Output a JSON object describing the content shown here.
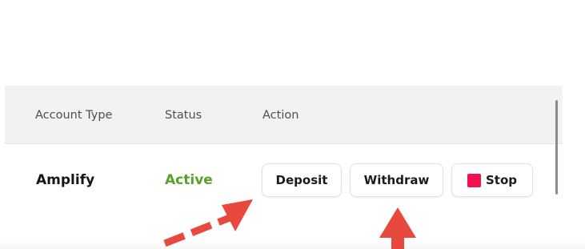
{
  "table": {
    "columns": [
      {
        "label": "Account Type"
      },
      {
        "label": "Status"
      },
      {
        "label": "Action"
      }
    ],
    "rows": [
      {
        "account_type": "Amplify",
        "status": "Active",
        "actions": {
          "deposit_label": "Deposit",
          "withdraw_label": "Withdraw",
          "stop_label": "Stop"
        }
      }
    ]
  },
  "colors": {
    "status_active": "#5aa02c",
    "stop_square": "#f0134f",
    "annotation_arrow": "#e8493f",
    "header_background": "#f3f2f2"
  },
  "icons": {
    "stop": "stop-square-icon",
    "annotation_dashed": "dashed-arrow-icon",
    "annotation_up": "up-arrow-icon"
  }
}
